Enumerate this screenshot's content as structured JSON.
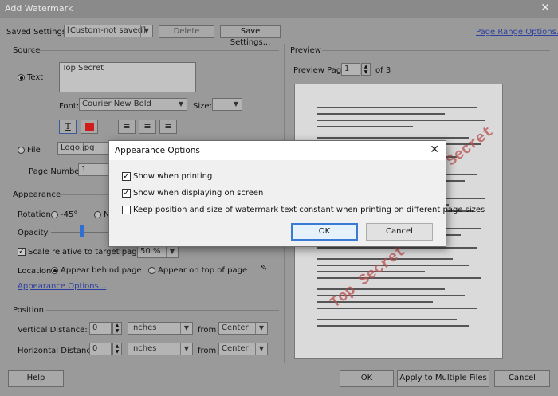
{
  "window": {
    "title": "Add Watermark",
    "close_glyph": "✕"
  },
  "settings": {
    "label": "Saved Settings:",
    "value": "[Custom-not saved]",
    "delete_label": "Delete",
    "save_label": "Save Settings...",
    "page_range_label": "Page Range Options..."
  },
  "source": {
    "heading": "Source",
    "text_label": "Text",
    "text_value": "Top Secret",
    "font_label": "Font:",
    "font_value": "Courier New Bold",
    "size_label": "Size:",
    "size_value": "",
    "text_color": "#d11a1a",
    "file_label": "File",
    "file_value": "Logo.jpg",
    "page_number_label": "Page Number:",
    "page_number_value": "1"
  },
  "appearance": {
    "heading": "Appearance",
    "rotation_label": "Rotation:",
    "rotation_opt1": "-45°",
    "rotation_opt2": "N",
    "opacity_label": "Opacity:",
    "opacity_value": 0.35,
    "scale_label": "Scale relative to target page",
    "scale_value": "50 %",
    "location_label": "Location:",
    "behind_label": "Appear behind page",
    "ontop_label": "Appear on top of page",
    "options_link": "Appearance Options..."
  },
  "position": {
    "heading": "Position",
    "vertical_label": "Vertical Distance:",
    "vertical_value": "0",
    "vertical_unit": "Inches",
    "vertical_from_label": "from",
    "vertical_from": "Center",
    "horizontal_label": "Horizontal Distance:",
    "horizontal_value": "0",
    "horizontal_unit": "Inches",
    "horizontal_from_label": "from",
    "horizontal_from": "Center"
  },
  "preview": {
    "heading": "Preview",
    "page_label": "Preview Page",
    "page_value": "1",
    "of_label": "of 3",
    "watermark_text": "Top Secret"
  },
  "footer": {
    "help_label": "Help",
    "ok_label": "OK",
    "apply_label": "Apply to Multiple Files",
    "cancel_label": "Cancel"
  },
  "dialog": {
    "title": "Appearance Options",
    "close_glyph": "✕",
    "opt1_label": "Show when printing",
    "opt1_checked": true,
    "opt2_label": "Show when displaying on screen",
    "opt2_checked": true,
    "opt3_label": "Keep position and size of watermark text constant when printing on different page sizes",
    "opt3_checked": false,
    "ok_label": "OK",
    "cancel_label": "Cancel"
  }
}
